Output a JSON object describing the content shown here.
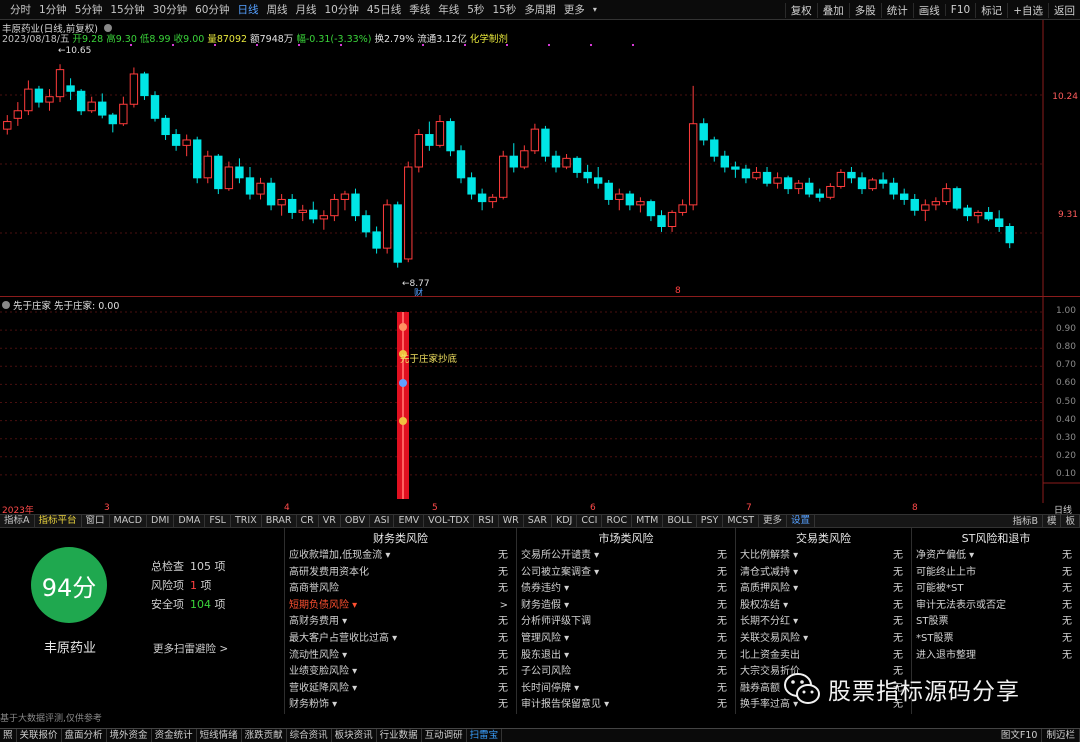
{
  "topbar": {
    "periods": [
      "分时",
      "1分钟",
      "5分钟",
      "15分钟",
      "30分钟",
      "60分钟",
      "日线",
      "周线",
      "月线",
      "10分钟",
      "45日线",
      "季线",
      "年线",
      "5秒",
      "15秒",
      "多周期",
      "更多"
    ],
    "active_period": "日线",
    "right_buttons": [
      "复权",
      "叠加",
      "多股",
      "统计",
      "画线",
      "F10",
      "标记",
      "+自选",
      "返回"
    ]
  },
  "chart": {
    "title": "丰原药业(日线,前复权)",
    "date": "2023/08/18/五",
    "open_label": "开",
    "open": "9.28",
    "high_label": "高",
    "high": "9.30",
    "low_label": "低",
    "low": "8.99",
    "close_label": "收",
    "close": "9.00",
    "volume_label": "量",
    "volume": "87092",
    "amount_label": "额",
    "amount": "7948万",
    "change_label": "幅",
    "change": "-0.31(-3.33%)",
    "turnover_label": "换",
    "turnover": "2.79%",
    "float_label": "流通",
    "float_shares": "3.12亿",
    "industry": "化学制剂",
    "high_marker": "10.65",
    "low_marker": "8.77",
    "event_marker_cai": "财",
    "event_marker_x": "8",
    "y_axis": [
      "10.24",
      "9.31"
    ],
    "x_axis": [
      {
        "label": "2023年"
      },
      {
        "label": "3"
      },
      {
        "label": "4"
      },
      {
        "label": "5"
      },
      {
        "label": "6"
      },
      {
        "label": "7"
      },
      {
        "label": "8"
      }
    ],
    "period_label": "日线"
  },
  "chart_data": {
    "type": "candlestick",
    "title": "丰原药业(日线,前复权)",
    "ylim": [
      8.6,
      10.8
    ],
    "y_ticks": [
      10.24,
      9.31
    ],
    "x_ticks": [
      "2023年",
      "3",
      "4",
      "5",
      "6",
      "7",
      "8"
    ],
    "ohlc": [
      [
        10.05,
        10.18,
        10.0,
        10.12
      ],
      [
        10.15,
        10.3,
        10.08,
        10.22
      ],
      [
        10.22,
        10.5,
        10.18,
        10.42
      ],
      [
        10.42,
        10.45,
        10.25,
        10.3
      ],
      [
        10.3,
        10.42,
        10.22,
        10.35
      ],
      [
        10.35,
        10.65,
        10.3,
        10.6
      ],
      [
        10.45,
        10.52,
        10.32,
        10.4
      ],
      [
        10.4,
        10.42,
        10.18,
        10.22
      ],
      [
        10.22,
        10.35,
        10.2,
        10.3
      ],
      [
        10.3,
        10.38,
        10.15,
        10.18
      ],
      [
        10.18,
        10.2,
        10.02,
        10.1
      ],
      [
        10.1,
        10.35,
        10.08,
        10.28
      ],
      [
        10.28,
        10.62,
        10.25,
        10.56
      ],
      [
        10.56,
        10.58,
        10.32,
        10.36
      ],
      [
        10.36,
        10.4,
        10.12,
        10.15
      ],
      [
        10.15,
        10.18,
        9.95,
        10.0
      ],
      [
        10.0,
        10.05,
        9.85,
        9.9
      ],
      [
        9.9,
        10.0,
        9.8,
        9.95
      ],
      [
        9.95,
        9.98,
        9.55,
        9.6
      ],
      [
        9.6,
        9.85,
        9.55,
        9.8
      ],
      [
        9.8,
        9.82,
        9.45,
        9.5
      ],
      [
        9.5,
        9.75,
        9.48,
        9.7
      ],
      [
        9.7,
        9.78,
        9.55,
        9.6
      ],
      [
        9.6,
        9.7,
        9.4,
        9.45
      ],
      [
        9.45,
        9.6,
        9.4,
        9.55
      ],
      [
        9.55,
        9.6,
        9.3,
        9.35
      ],
      [
        9.35,
        9.45,
        9.25,
        9.4
      ],
      [
        9.4,
        9.45,
        9.22,
        9.28
      ],
      [
        9.28,
        9.35,
        9.2,
        9.3
      ],
      [
        9.3,
        9.38,
        9.18,
        9.22
      ],
      [
        9.22,
        9.3,
        9.12,
        9.25
      ],
      [
        9.25,
        9.45,
        9.2,
        9.4
      ],
      [
        9.4,
        9.48,
        9.3,
        9.45
      ],
      [
        9.45,
        9.5,
        9.2,
        9.25
      ],
      [
        9.25,
        9.3,
        9.05,
        9.1
      ],
      [
        9.1,
        9.15,
        8.9,
        8.95
      ],
      [
        8.95,
        9.4,
        8.9,
        9.35
      ],
      [
        9.35,
        9.38,
        8.77,
        8.82
      ],
      [
        8.85,
        9.75,
        8.82,
        9.7
      ],
      [
        9.7,
        10.05,
        9.65,
        10.0
      ],
      [
        10.0,
        10.12,
        9.85,
        9.9
      ],
      [
        9.9,
        10.18,
        9.88,
        10.12
      ],
      [
        10.12,
        10.15,
        9.8,
        9.85
      ],
      [
        9.85,
        9.9,
        9.55,
        9.6
      ],
      [
        9.6,
        9.65,
        9.4,
        9.45
      ],
      [
        9.45,
        9.5,
        9.3,
        9.38
      ],
      [
        9.38,
        9.45,
        9.32,
        9.42
      ],
      [
        9.42,
        9.85,
        9.4,
        9.8
      ],
      [
        9.8,
        9.92,
        9.65,
        9.7
      ],
      [
        9.7,
        9.9,
        9.68,
        9.85
      ],
      [
        9.85,
        10.1,
        9.82,
        10.05
      ],
      [
        10.05,
        10.08,
        9.75,
        9.8
      ],
      [
        9.8,
        9.85,
        9.65,
        9.7
      ],
      [
        9.7,
        9.82,
        9.68,
        9.78
      ],
      [
        9.78,
        9.8,
        9.6,
        9.65
      ],
      [
        9.65,
        9.72,
        9.55,
        9.6
      ],
      [
        9.6,
        9.7,
        9.5,
        9.55
      ],
      [
        9.55,
        9.58,
        9.35,
        9.4
      ],
      [
        9.4,
        9.5,
        9.3,
        9.45
      ],
      [
        9.45,
        9.48,
        9.3,
        9.35
      ],
      [
        9.35,
        9.42,
        9.28,
        9.38
      ],
      [
        9.38,
        9.4,
        9.2,
        9.25
      ],
      [
        9.25,
        9.3,
        9.1,
        9.15
      ],
      [
        9.15,
        9.3,
        9.1,
        9.28
      ],
      [
        9.28,
        9.4,
        9.25,
        9.35
      ],
      [
        9.35,
        10.45,
        9.3,
        10.1
      ],
      [
        10.1,
        10.15,
        9.9,
        9.95
      ],
      [
        9.95,
        9.98,
        9.75,
        9.8
      ],
      [
        9.8,
        9.85,
        9.65,
        9.7
      ],
      [
        9.7,
        9.75,
        9.6,
        9.68
      ],
      [
        9.68,
        9.72,
        9.55,
        9.6
      ],
      [
        9.6,
        9.7,
        9.58,
        9.65
      ],
      [
        9.65,
        9.7,
        9.52,
        9.55
      ],
      [
        9.55,
        9.65,
        9.5,
        9.6
      ],
      [
        9.6,
        9.62,
        9.45,
        9.5
      ],
      [
        9.5,
        9.58,
        9.45,
        9.55
      ],
      [
        9.55,
        9.6,
        9.42,
        9.45
      ],
      [
        9.45,
        9.5,
        9.38,
        9.42
      ],
      [
        9.42,
        9.55,
        9.4,
        9.52
      ],
      [
        9.52,
        9.68,
        9.5,
        9.65
      ],
      [
        9.65,
        9.7,
        9.55,
        9.6
      ],
      [
        9.6,
        9.65,
        9.45,
        9.5
      ],
      [
        9.5,
        9.6,
        9.48,
        9.58
      ],
      [
        9.58,
        9.65,
        9.5,
        9.55
      ],
      [
        9.55,
        9.6,
        9.4,
        9.45
      ],
      [
        9.45,
        9.5,
        9.35,
        9.4
      ],
      [
        9.4,
        9.45,
        9.25,
        9.3
      ],
      [
        9.3,
        9.4,
        9.2,
        9.35
      ],
      [
        9.35,
        9.42,
        9.3,
        9.38
      ],
      [
        9.38,
        9.55,
        9.35,
        9.5
      ],
      [
        9.5,
        9.52,
        9.3,
        9.32
      ],
      [
        9.32,
        9.35,
        9.2,
        9.25
      ],
      [
        9.25,
        9.3,
        9.18,
        9.28
      ],
      [
        9.28,
        9.33,
        9.2,
        9.22
      ],
      [
        9.22,
        9.3,
        9.1,
        9.15
      ],
      [
        9.15,
        9.18,
        8.95,
        9.0
      ]
    ]
  },
  "subchart": {
    "title": "先于庄家 先于庄家: 0.00",
    "signal_label": "先于庄家抄底",
    "y_axis": [
      "1.00",
      "0.90",
      "0.80",
      "0.70",
      "0.60",
      "0.50",
      "0.40",
      "0.30",
      "0.20",
      "0.10"
    ]
  },
  "tabs": {
    "items": [
      "指标A",
      "指标平台",
      "窗口",
      "MACD",
      "DMI",
      "DMA",
      "FSL",
      "TRIX",
      "BRAR",
      "CR",
      "VR",
      "OBV",
      "ASI",
      "EMV",
      "VOL-TDX",
      "RSI",
      "WR",
      "SAR",
      "KDJ",
      "CCI",
      "ROC",
      "MTM",
      "BOLL",
      "PSY",
      "MCST",
      "更多",
      "设置"
    ],
    "active": "指标平台",
    "right": [
      "指标B",
      "模",
      "板"
    ]
  },
  "risk": {
    "score": "94分",
    "stock_name": "丰原药业",
    "total_label": "总检查",
    "total": "105",
    "risk_label": "风险项",
    "risk_count": "1",
    "safe_label": "安全项",
    "safe_count": "104",
    "unit": "项",
    "more_link": "更多扫雷避险 >",
    "source_note": "基于大数据评测,仅供参考",
    "columns": [
      {
        "title": "财务类风险",
        "items": [
          {
            "name": "应收款增加,低现金流 ▾",
            "value": "无"
          },
          {
            "name": "高研发费用资本化",
            "value": "无"
          },
          {
            "name": "高商誉风险",
            "value": "无"
          },
          {
            "name": "短期负债风险 ▾",
            "value": ">",
            "highlight": true
          },
          {
            "name": "高财务费用 ▾",
            "value": "无"
          },
          {
            "name": "最大客户占营收比过高 ▾",
            "value": "无"
          },
          {
            "name": "流动性风险 ▾",
            "value": "无"
          },
          {
            "name": "业绩变脸风险 ▾",
            "value": "无"
          },
          {
            "name": "营收延降风险 ▾",
            "value": "无"
          },
          {
            "name": "财务粉饰 ▾",
            "value": "无"
          }
        ]
      },
      {
        "title": "市场类风险",
        "items": [
          {
            "name": "交易所公开谴责 ▾",
            "value": "无"
          },
          {
            "name": "公司被立案调查 ▾",
            "value": "无"
          },
          {
            "name": "债券违约 ▾",
            "value": "无"
          },
          {
            "name": "财务造假 ▾",
            "value": "无"
          },
          {
            "name": "分析师评级下调",
            "value": "无"
          },
          {
            "name": "管理风险 ▾",
            "value": "无"
          },
          {
            "name": "股东退出 ▾",
            "value": "无"
          },
          {
            "name": "子公司风险",
            "value": "无"
          },
          {
            "name": "长时间停牌 ▾",
            "value": "无"
          },
          {
            "name": "审计报告保留意见 ▾",
            "value": "无"
          }
        ]
      },
      {
        "title": "交易类风险",
        "items": [
          {
            "name": "大比例解禁 ▾",
            "value": "无"
          },
          {
            "name": "清仓式减持 ▾",
            "value": "无"
          },
          {
            "name": "高质押风险 ▾",
            "value": "无"
          },
          {
            "name": "股权冻结 ▾",
            "value": "无"
          },
          {
            "name": "长期不分红 ▾",
            "value": "无"
          },
          {
            "name": "关联交易风险 ▾",
            "value": "无"
          },
          {
            "name": "北上资金卖出",
            "value": "无"
          },
          {
            "name": "大宗交易折价",
            "value": "无"
          },
          {
            "name": "融券高额",
            "value": "无"
          },
          {
            "name": "换手率过高 ▾",
            "value": "无"
          }
        ]
      },
      {
        "title": "ST风险和退市",
        "items": [
          {
            "name": "净资产偏低 ▾",
            "value": "无"
          },
          {
            "name": "可能终止上市",
            "value": "无"
          },
          {
            "name": "可能被*ST",
            "value": "无"
          },
          {
            "name": "审计无法表示或否定",
            "value": "无"
          },
          {
            "name": "ST股票",
            "value": "无"
          },
          {
            "name": "*ST股票",
            "value": "无"
          },
          {
            "name": "进入退市整理",
            "value": "无"
          }
        ]
      }
    ]
  },
  "bottombar": {
    "items": [
      "照",
      "关联报价",
      "盘面分析",
      "境外资金",
      "资金统计",
      "短线情绪",
      "涨跌贡献",
      "综合资讯",
      "板块资讯",
      "行业数据",
      "互动调研",
      "扫雷宝"
    ],
    "active": "扫雷宝",
    "right": [
      "图文F10",
      "制迈栏"
    ]
  },
  "watermark": {
    "text": "股票指标源码分享"
  },
  "colors": {
    "up": "#ff3c3c",
    "down": "#00e5e5",
    "grid": "#5a1010",
    "accent": "#1fa84f"
  }
}
